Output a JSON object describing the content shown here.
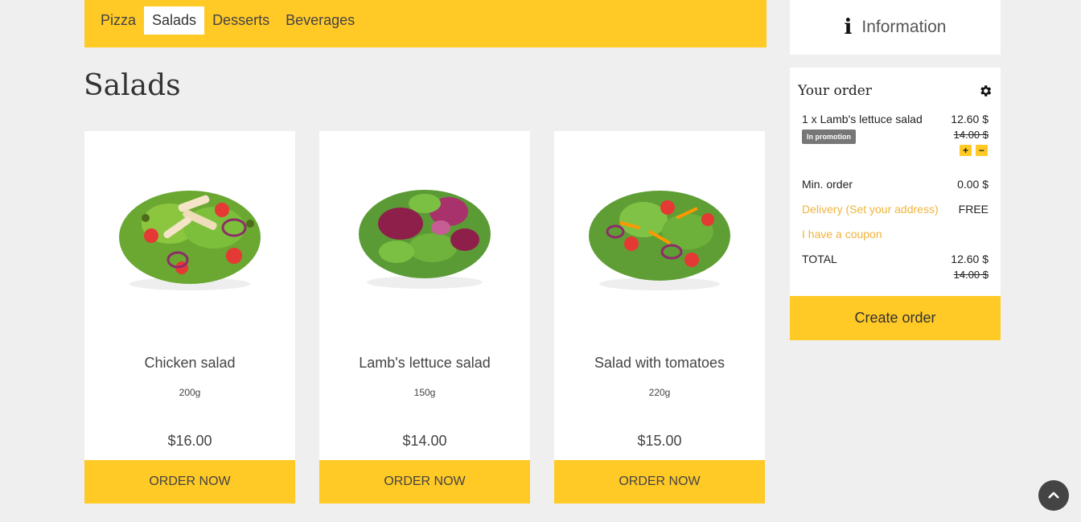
{
  "nav": {
    "tabs": [
      {
        "label": "Pizza"
      },
      {
        "label": "Salads"
      },
      {
        "label": "Desserts"
      },
      {
        "label": "Beverages"
      }
    ],
    "active_tab": "Salads"
  },
  "section": {
    "title": "Salads"
  },
  "products": [
    {
      "name": "Chicken salad",
      "weight": "200g",
      "price": "$16.00",
      "button": "ORDER NOW"
    },
    {
      "name": "Lamb's lettuce salad",
      "weight": "150g",
      "price": "$14.00",
      "button": "ORDER NOW"
    },
    {
      "name": "Salad with tomatoes",
      "weight": "220g",
      "price": "$15.00",
      "button": "ORDER NOW"
    }
  ],
  "info": {
    "icon": "info-icon",
    "label": "Information"
  },
  "order": {
    "title": "Your order",
    "settings_icon": "gear-icon",
    "item": {
      "text": "1 x Lamb's lettuce salad",
      "price": "12.60 $",
      "old_price": "14.00 $",
      "badge": "In promotion",
      "plus": "+",
      "minus": "−"
    },
    "min_order_label": "Min. order",
    "min_order_value": "0.00 $",
    "delivery_label": "Delivery (Set your address)",
    "delivery_value": "FREE",
    "coupon_label": "I have a coupon",
    "total_label": "TOTAL",
    "total_value": "12.60 $",
    "total_old": "14.00 $"
  },
  "create_order": {
    "label": "Create order"
  },
  "colors": {
    "accent": "#ffc926",
    "link": "#f0b43c",
    "background": "#efefef"
  },
  "scroll_top_icon": "chevron-up-icon"
}
